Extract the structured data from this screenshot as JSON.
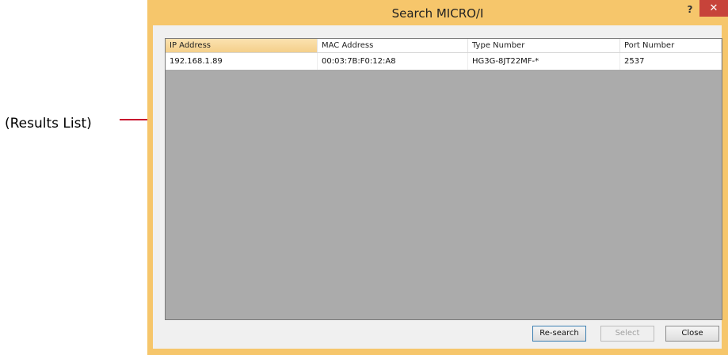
{
  "callout": {
    "label": "(Results List)"
  },
  "dialog": {
    "title": "Search MICRO/I",
    "help_label": "?",
    "close_label": "✕"
  },
  "results_table": {
    "columns": [
      "IP Address",
      "MAC Address",
      "Type Number",
      "Port Number"
    ],
    "rows": [
      [
        "192.168.1.89",
        "00:03:7B:F0:12:A8",
        "HG3G-8JT22MF-*",
        "2537"
      ]
    ]
  },
  "buttons": {
    "research": "Re-search",
    "select": "Select",
    "close": "Close"
  },
  "colors": {
    "frame": "#f6c66b",
    "close_button": "#c7433a",
    "callout_line": "#c8102e",
    "list_background": "#ababab"
  }
}
